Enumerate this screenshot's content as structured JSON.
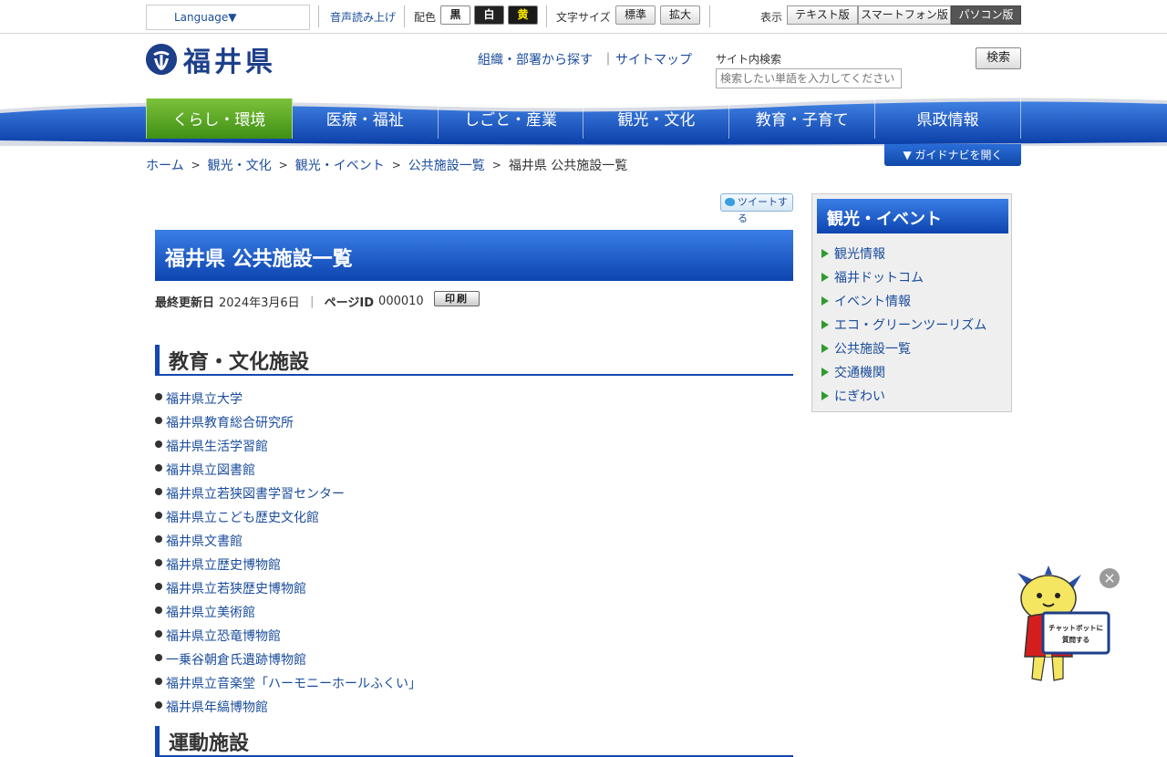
{
  "util": {
    "language": "Language▼",
    "voice": "音声読み上げ",
    "color_label": "配色",
    "color_black": "黒",
    "color_white": "白",
    "color_yellow": "黄",
    "fontsize_label": "文字サイズ",
    "font_standard": "標準",
    "font_large": "拡大",
    "display_label": "表示",
    "view_text": "テキスト版",
    "view_smartphone": "スマートフォン版",
    "view_pc": "パソコン版"
  },
  "header": {
    "site_title": "福井県",
    "link_org": "組織・部署から探す",
    "link_sep": "｜",
    "link_sitemap": "サイトマップ",
    "search_label": "サイト内検索",
    "search_placeholder": "検索したい単語を入力してください",
    "search_button": "検索"
  },
  "gnav": [
    "くらし・環境",
    "医療・福祉",
    "しごと・産業",
    "観光・文化",
    "教育・子育て",
    "県政情報"
  ],
  "breadcrumb": {
    "items": [
      "ホーム",
      "観光・文化",
      "観光・イベント",
      "公共施設一覧"
    ],
    "current": "福井県 公共施設一覧",
    "sep": ">"
  },
  "guide_button": "▼ ガイドナビを開く",
  "tweet_button": "ツイートする",
  "page": {
    "title": "福井県 公共施設一覧",
    "updated_label": "最終更新日",
    "updated_value": "2024年3月6日",
    "meta_sep": "｜",
    "page_id_label": "ページID",
    "page_id_value": "000010",
    "print_button": "印刷"
  },
  "sections": [
    {
      "heading": "教育・文化施設",
      "items": [
        "福井県立大学",
        "福井県教育総合研究所",
        "福井県生活学習館",
        "福井県立図書館",
        "福井県立若狭図書学習センター",
        "福井県立こども歴史文化館",
        "福井県文書館",
        "福井県立歴史博物館",
        "福井県立若狭歴史博物館",
        "福井県立美術館",
        "福井県立恐竜博物館",
        "一乗谷朝倉氏遺跡博物館",
        "福井県立音楽堂「ハーモニーホールふくい」",
        "福井県年縞博物館"
      ]
    },
    {
      "heading": "運動施設"
    }
  ],
  "sidenav": {
    "heading": "観光・イベント",
    "items": [
      "観光情報",
      "福井ドットコム",
      "イベント情報",
      "エコ・グリーンツーリズム",
      "公共施設一覧",
      "交通機関",
      "にぎわい"
    ]
  },
  "chatbot": {
    "line1": "チャットボットに",
    "line2": "質問する",
    "close": "×"
  },
  "colors": {
    "brand_blue": "#1d3f8a",
    "nav_blue": "#0d44b0",
    "nav_active_green": "#5aa826",
    "link": "#1a4c9b",
    "highlight_yellow": "#f5e600"
  }
}
